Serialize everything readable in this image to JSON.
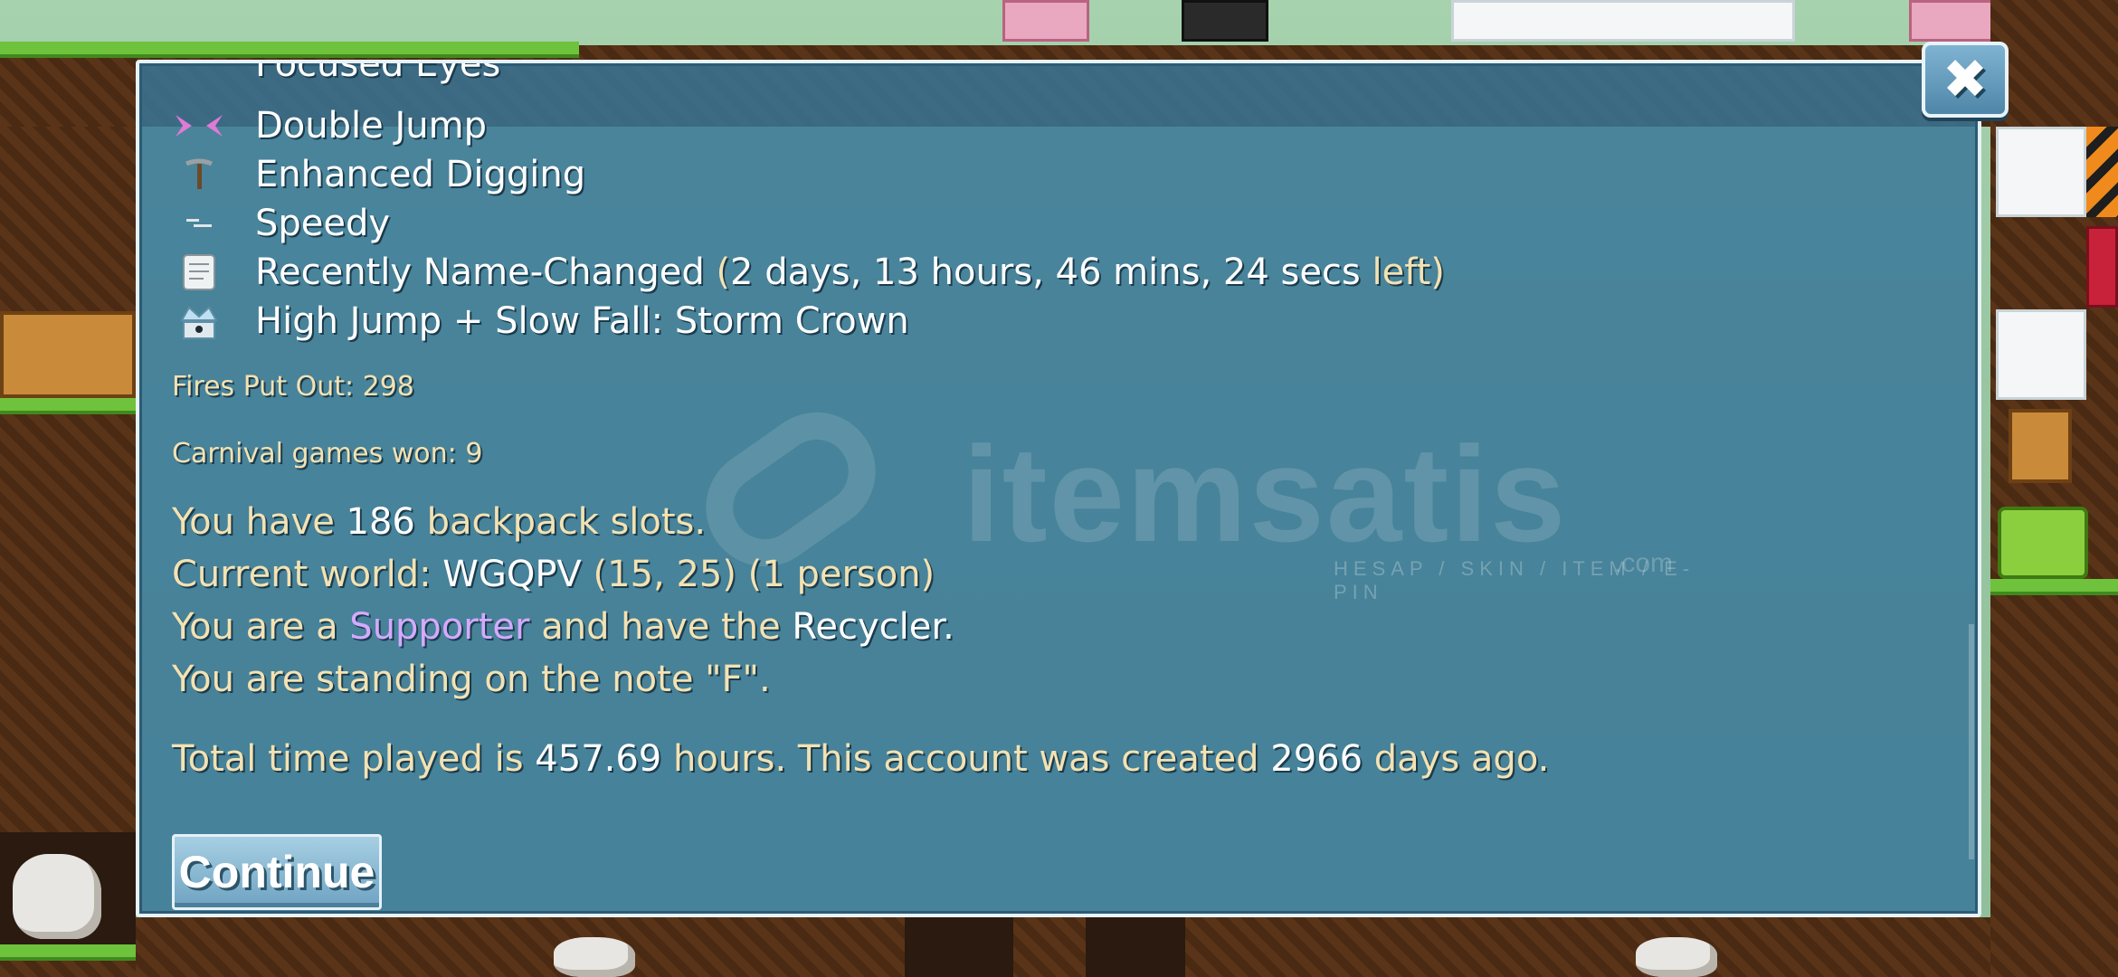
{
  "dialog": {
    "cut_line": "Focused Eyes",
    "mods": [
      {
        "icon": "double-jump-icon",
        "label": "Double Jump"
      },
      {
        "icon": "pickaxe-icon",
        "label": "Enhanced Digging"
      },
      {
        "icon": "speedy-icon",
        "label": "Speedy"
      },
      {
        "icon": "scroll-icon",
        "label": "Recently Name-Changed",
        "paren_open": "(",
        "detail": "2 days, 13 hours, 46 mins, 24 secs",
        "detail_tail": "left)"
      },
      {
        "icon": "storm-crown-icon",
        "label": "High Jump + Slow Fall: Storm Crown"
      }
    ],
    "fires_put_out": "Fires Put Out: 298",
    "carnival": "Carnival games won: 9",
    "backpack": {
      "pre": "You have",
      "value": "186",
      "post": "backpack slots."
    },
    "world": {
      "pre": "Current world:",
      "name": "WGQPV",
      "coords": "(15, 25) (1 person)"
    },
    "supporter": {
      "pre": "You are a",
      "role": "Supporter",
      "mid": "and have the",
      "item": "Recycler",
      "post": "."
    },
    "note": "You are standing on the note \"F\".",
    "playtime": {
      "pre": "Total time played is",
      "hours": "457.69",
      "mid": "hours.  This account was created",
      "days": "2966",
      "post": "days ago."
    },
    "continue_label": "Continue",
    "close_label": "✖"
  },
  "watermark": {
    "brand": "itemsatis",
    "sub": "HESAP / SKIN / ITEM / E-PIN",
    "tld": ".com"
  },
  "colors": {
    "panel": "#387698",
    "cream_text": "#f3e2b3",
    "white_text": "#ffffff",
    "supporter": "#d6a9ff"
  }
}
